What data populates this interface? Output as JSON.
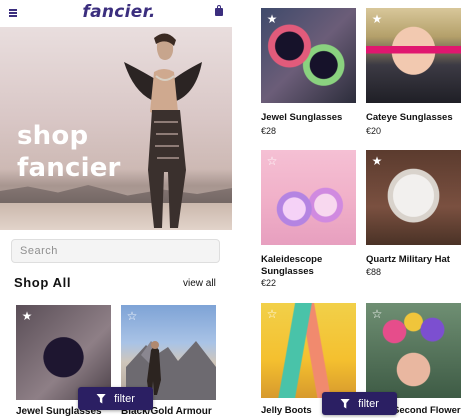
{
  "left": {
    "header": {
      "logo": "fancier."
    },
    "hero": {
      "line1": "shop",
      "line2": "fancier"
    },
    "search": {
      "placeholder": "Search"
    },
    "section": {
      "title": "Shop All",
      "view_all": "view all"
    },
    "products": [
      {
        "name": "Jewel Sunglasses"
      },
      {
        "name": "Black/Gold Armour"
      }
    ],
    "filter": {
      "label": "filter"
    }
  },
  "right": {
    "products": [
      {
        "name": "Jewel Sunglasses",
        "price": "€28",
        "favorited": true
      },
      {
        "name": "Cateye Sunglasses",
        "price": "€20",
        "favorited": true
      },
      {
        "name": "Kaleidescope Sunglasses",
        "price": "€22",
        "favorited": false
      },
      {
        "name": "Quartz Military Hat",
        "price": "€88",
        "favorited": true
      },
      {
        "name": "Jelly Boots",
        "price": "",
        "favorited": false
      },
      {
        "name": "Second Flower",
        "price": "",
        "favorited": false
      }
    ],
    "filter": {
      "label": "filter"
    }
  },
  "colors": {
    "brand": "#3b2e7e",
    "filter_button": "#2b1f63"
  },
  "icons": [
    "menu-icon",
    "bag-icon",
    "star-icon",
    "filter-funnel-icon"
  ]
}
